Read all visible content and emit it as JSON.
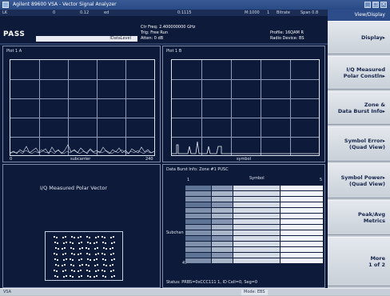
{
  "window": {
    "title": "Agilent 89600 VSA - Vector Signal Analyzer"
  },
  "header": {
    "cells": [
      "LK",
      "0",
      "0.12",
      "ed",
      "0:1115",
      "M:1000",
      "1",
      "Bitrate",
      "Span 0.8"
    ],
    "status": "PASS",
    "label_bar": "IDataLevel",
    "center_freq": "Ctr Freq: 2.400000000 GHz",
    "trig": "Trig: Free Run",
    "atten": "Atten: 0 dB",
    "profile": "Profile: 16QAM R",
    "radio": "Radio Device: BS"
  },
  "panels": {
    "top_left": {
      "title": "Plot 1 A",
      "x_left": "0",
      "x_center": "subcarrier",
      "x_right": "240"
    },
    "top_right": {
      "title": "Plot 1 B",
      "x_center": "symbol"
    },
    "bottom_left": {
      "title": "I/Q Measured Polar Vector"
    },
    "bottom_right": {
      "title": "Data Burst Info: Zone #1 PUSC",
      "col_header": "Symbol",
      "col_left": "1",
      "col_right": "5",
      "row_label": "Subchan",
      "row_bottom": "47",
      "footer": "Status: PRBS=0xCCC111 1, ID Cell=0, Seg=0"
    }
  },
  "sidebar": {
    "header": "View/Display",
    "buttons": [
      {
        "label": "Display",
        "label2": "",
        "arrow": "▸"
      },
      {
        "label": "I/Q Measured",
        "label2": "Polar Constln",
        "arrow": "▸"
      },
      {
        "label": "Zone &",
        "label2": "Data Burst Info",
        "arrow": "▸"
      },
      {
        "label": "Symbol Error",
        "label2": "(Quad View)",
        "arrow": "▸"
      },
      {
        "label": "Symbol Power",
        "label2": "(Quad View)",
        "arrow": "▸"
      },
      {
        "label": "Peak/Avg",
        "label2": "Metrics",
        "arrow": ""
      },
      {
        "label": "More",
        "label2": "1 of 2",
        "arrow": ""
      }
    ]
  },
  "statusbar": {
    "left": "VSA",
    "center": "Mode: EBS"
  },
  "colors": {
    "background": "#0d1a3a",
    "sidebar": "#c6ccd4",
    "title": "#2c4d8a"
  }
}
